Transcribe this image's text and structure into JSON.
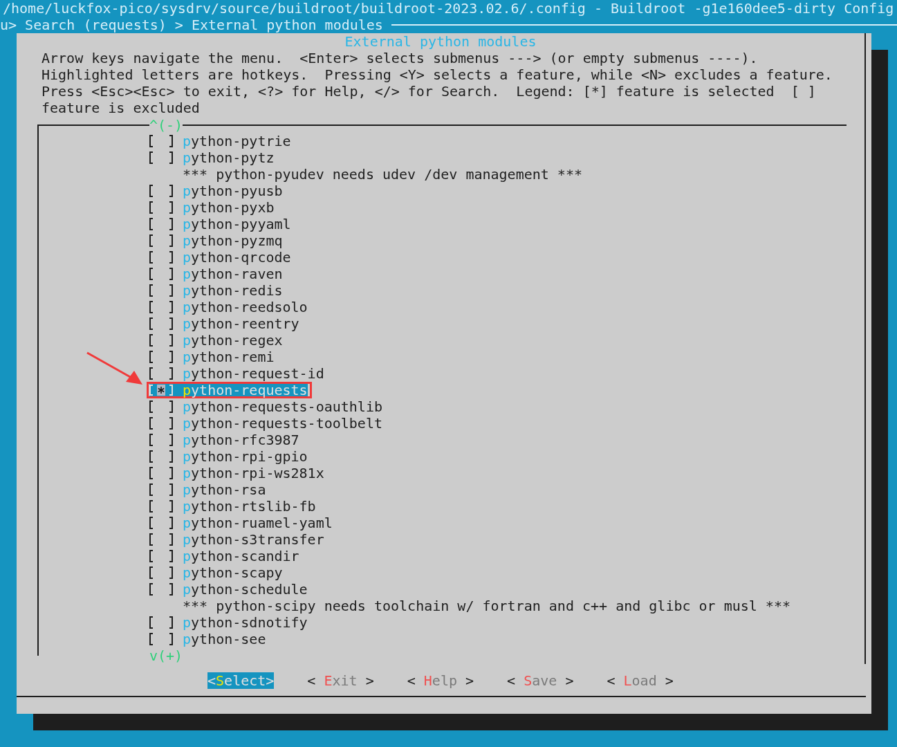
{
  "window": {
    "title": "/home/luckfox-pico/sysdrv/source/buildroot/buildroot-2023.02.6/.config - Buildroot -g1e160dee5-dirty Config",
    "breadcrumb": "u> Search (requests) > External python modules"
  },
  "dialog": {
    "title": "External python modules",
    "help_lines": [
      "Arrow keys navigate the menu.  <Enter> selects submenus ---> (or empty submenus ----).",
      "Highlighted letters are hotkeys.  Pressing <Y> selects a feature, while <N> excludes a feature.",
      "Press <Esc><Esc> to exit, <?> for Help, </> for Search.  Legend: [*] feature is selected  [ ]",
      "feature is excluded"
    ],
    "scroll_up": "^(-)",
    "scroll_down": "v(+)",
    "items": [
      {
        "kind": "option",
        "label": "python-pytrie",
        "checked": false,
        "selected": false
      },
      {
        "kind": "option",
        "label": "python-pytz",
        "checked": false,
        "selected": false
      },
      {
        "kind": "comment",
        "label": "*** python-pyudev needs udev /dev management ***"
      },
      {
        "kind": "option",
        "label": "python-pyusb",
        "checked": false,
        "selected": false
      },
      {
        "kind": "option",
        "label": "python-pyxb",
        "checked": false,
        "selected": false
      },
      {
        "kind": "option",
        "label": "python-pyyaml",
        "checked": false,
        "selected": false
      },
      {
        "kind": "option",
        "label": "python-pyzmq",
        "checked": false,
        "selected": false
      },
      {
        "kind": "option",
        "label": "python-qrcode",
        "checked": false,
        "selected": false
      },
      {
        "kind": "option",
        "label": "python-raven",
        "checked": false,
        "selected": false
      },
      {
        "kind": "option",
        "label": "python-redis",
        "checked": false,
        "selected": false
      },
      {
        "kind": "option",
        "label": "python-reedsolo",
        "checked": false,
        "selected": false
      },
      {
        "kind": "option",
        "label": "python-reentry",
        "checked": false,
        "selected": false
      },
      {
        "kind": "option",
        "label": "python-regex",
        "checked": false,
        "selected": false
      },
      {
        "kind": "option",
        "label": "python-remi",
        "checked": false,
        "selected": false
      },
      {
        "kind": "option",
        "label": "python-request-id",
        "checked": false,
        "selected": false
      },
      {
        "kind": "option",
        "label": "python-requests",
        "checked": true,
        "selected": true
      },
      {
        "kind": "option",
        "label": "python-requests-oauthlib",
        "checked": false,
        "selected": false
      },
      {
        "kind": "option",
        "label": "python-requests-toolbelt",
        "checked": false,
        "selected": false
      },
      {
        "kind": "option",
        "label": "python-rfc3987",
        "checked": false,
        "selected": false
      },
      {
        "kind": "option",
        "label": "python-rpi-gpio",
        "checked": false,
        "selected": false
      },
      {
        "kind": "option",
        "label": "python-rpi-ws281x",
        "checked": false,
        "selected": false
      },
      {
        "kind": "option",
        "label": "python-rsa",
        "checked": false,
        "selected": false
      },
      {
        "kind": "option",
        "label": "python-rtslib-fb",
        "checked": false,
        "selected": false
      },
      {
        "kind": "option",
        "label": "python-ruamel-yaml",
        "checked": false,
        "selected": false
      },
      {
        "kind": "option",
        "label": "python-s3transfer",
        "checked": false,
        "selected": false
      },
      {
        "kind": "option",
        "label": "python-scandir",
        "checked": false,
        "selected": false
      },
      {
        "kind": "option",
        "label": "python-scapy",
        "checked": false,
        "selected": false
      },
      {
        "kind": "option",
        "label": "python-schedule",
        "checked": false,
        "selected": false
      },
      {
        "kind": "comment",
        "label": "*** python-scipy needs toolchain w/ fortran and c++ and glibc or musl ***"
      },
      {
        "kind": "option",
        "label": "python-sdnotify",
        "checked": false,
        "selected": false
      },
      {
        "kind": "option",
        "label": "python-see",
        "checked": false,
        "selected": false
      }
    ],
    "buttons": [
      {
        "text": "<Select>",
        "selected": true
      },
      {
        "text": "< Exit >",
        "selected": false
      },
      {
        "text": "< Help >",
        "selected": false
      },
      {
        "text": "< Save >",
        "selected": false
      },
      {
        "text": "< Load >",
        "selected": false
      }
    ]
  }
}
